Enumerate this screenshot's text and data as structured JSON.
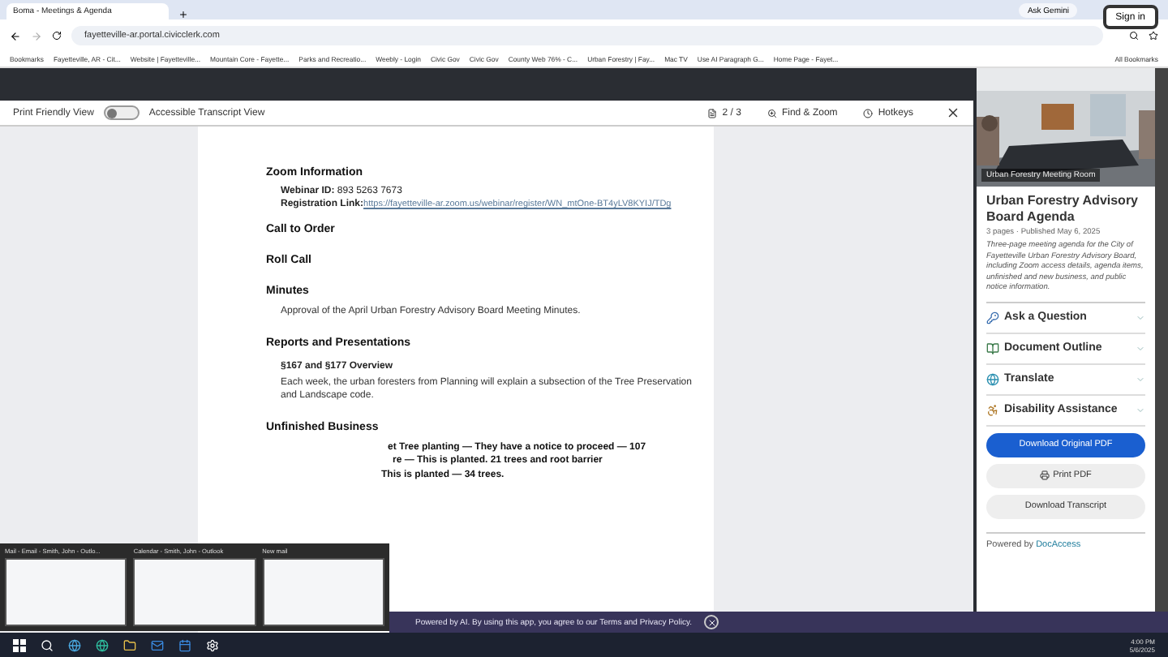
{
  "browser": {
    "tab_title": "Boma - Meetings & Agenda",
    "ask_button": "Ask Gemini",
    "sign_in": "Sign in",
    "address": "fayetteville-ar.portal.civicclerk.com",
    "bookmarks": [
      "Bookmarks",
      "Fayetteville, AR - Cit...",
      "Website | Fayetteville...",
      "Mountain Core - Fayette...",
      "Parks and Recreatio...",
      "Weebly - Login",
      "Civic Gov",
      "Civic Gov",
      "County Web 76% - C...",
      "Urban Forestry | Fay...",
      "Mac TV",
      "Use AI Paragraph G...",
      "Home Page - Fayet..."
    ],
    "all_bookmarks": "All Bookmarks"
  },
  "viewer_toolbar": {
    "print_friendly": {
      "label": "Print Friendly View",
      "on": false
    },
    "transcript_label": "Accessible Transcript View",
    "page": "2 / 3",
    "find": "Find & Zoom",
    "hotkeys": "Hotkeys"
  },
  "document": {
    "blocks": [
      {
        "kind": "heading",
        "text": "Zoom Information"
      },
      {
        "kind": "field",
        "label": "Webinar ID:",
        "text": "893 5263 7673"
      },
      {
        "kind": "link",
        "label": "Registration Link:",
        "text": "https://fayetteville-ar.zoom.us/webinar/register/WN_mtOne-BT4yLV8KYIJ/TDg"
      },
      {
        "kind": "heading",
        "text": "Call to Order"
      },
      {
        "kind": "heading",
        "text": "Roll Call"
      },
      {
        "kind": "heading",
        "text": "Minutes"
      },
      {
        "kind": "paragraph",
        "text": "Approval of the April Urban Forestry Advisory Board Meeting Minutes."
      },
      {
        "kind": "heading",
        "text": "Reports and Presentations"
      },
      {
        "kind": "subheading",
        "text": "§167 and §177 Overview"
      },
      {
        "kind": "paragraph",
        "text": "Each week, the urban foresters from Planning will explain a subsection of the Tree Preservation and Landscape code."
      },
      {
        "kind": "heading",
        "text": "Unfinished Business"
      },
      {
        "kind": "fragment",
        "text": "et Tree planting — They have a notice to proceed — 107"
      },
      {
        "kind": "fragment",
        "text": "re — This is planted. 21 trees and root barrier"
      },
      {
        "kind": "fragment",
        "text": "This is planted — 34 trees."
      }
    ]
  },
  "panel": {
    "video_caption": "Urban Forestry Meeting Room",
    "title": "Urban Forestry Advisory Board Agenda",
    "meta": "3 pages · Published May 6, 2025",
    "description": "Three-page meeting agenda for the City of Fayetteville Urban Forestry Advisory Board, including Zoom access details, agenda items, unfinished and new business, and public notice information.",
    "sections": [
      {
        "label": "Ask a Question"
      },
      {
        "label": "Document Outline"
      },
      {
        "label": "Translate"
      },
      {
        "label": "Disability Assistance"
      }
    ],
    "buttons": [
      {
        "label": "Download Original PDF",
        "kind": "primary"
      },
      {
        "label": "Print PDF",
        "kind": "print"
      },
      {
        "label": "Download Transcript",
        "kind": "plain"
      }
    ],
    "powered_prefix": "Powered by",
    "powered_link": "DocAccess"
  },
  "thumbnails": [
    {
      "title": "Mail - Email - Smith, John - Outlo..."
    },
    {
      "title": "Calendar - Smith, John - Outlook"
    },
    {
      "title": "New mail"
    }
  ],
  "banner": "Powered by AI. By using this app, you agree to our Terms and Privacy Policy.",
  "taskbar": {
    "time": "4:00 PM",
    "date": "5/6/2025"
  }
}
